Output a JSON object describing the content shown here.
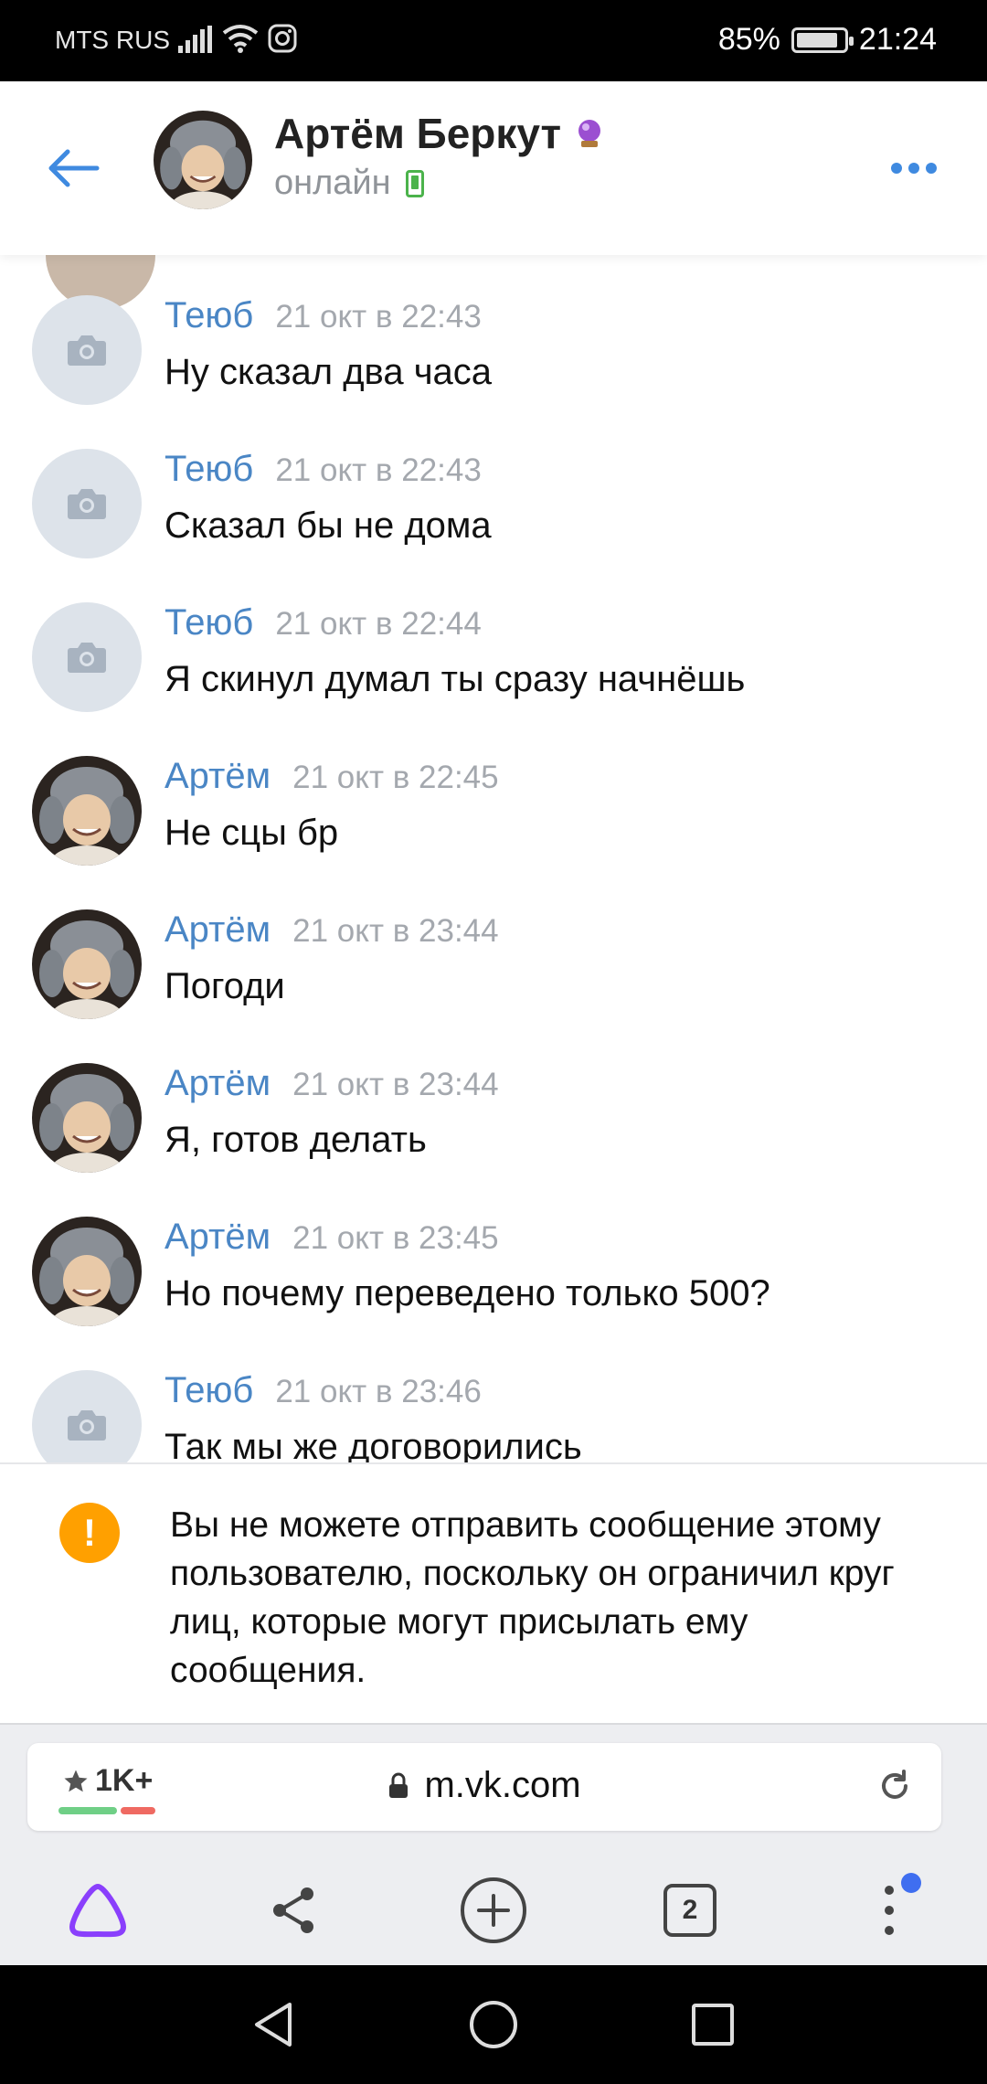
{
  "status_bar": {
    "carrier": "MTS RUS",
    "battery": "85%",
    "battery_level": 0.85,
    "time": "21:24"
  },
  "header": {
    "name": "Артём Беркут",
    "status": "онлайн"
  },
  "messages": [
    {
      "author": "Теюб",
      "time": "21 окт в 22:43",
      "text": "Ну сказал два часа",
      "avatar": "camera-placeholder"
    },
    {
      "author": "Теюб",
      "time": "21 окт в 22:43",
      "text": "Сказал бы не дома",
      "avatar": "camera-placeholder"
    },
    {
      "author": "Теюб",
      "time": "21 окт в 22:44",
      "text": "Я скинул думал ты сразу начнёшь",
      "avatar": "camera-placeholder"
    },
    {
      "author": "Артём",
      "time": "21 окт в 22:45",
      "text": "Не сцы бр",
      "avatar": "photo"
    },
    {
      "author": "Артём",
      "time": "21 окт в 23:44",
      "text": "Погоди",
      "avatar": "photo"
    },
    {
      "author": "Артём",
      "time": "21 окт в 23:44",
      "text": "Я, готов делать",
      "avatar": "photo"
    },
    {
      "author": "Артём",
      "time": "21 окт в 23:45",
      "text": "Но почему переведено только 500?",
      "avatar": "photo"
    },
    {
      "author": "Теюб",
      "time": "21 окт в 23:46",
      "text": "Так мы же договорились",
      "avatar": "camera-placeholder"
    }
  ],
  "notice": {
    "text": "Вы не можете отправить сообщение этому пользователю, поскольку он ограничил круг лиц, которые могут присылать ему сообщения.",
    "icon": "!"
  },
  "browser": {
    "rating": "1K+",
    "url": "m.vk.com",
    "tabs_count": "2"
  },
  "colors": {
    "accent": "#3f8ae0",
    "author": "#4a86c5",
    "warning": "#ffa000",
    "online": "#4bb34b",
    "alice": "#8a3ffc"
  }
}
